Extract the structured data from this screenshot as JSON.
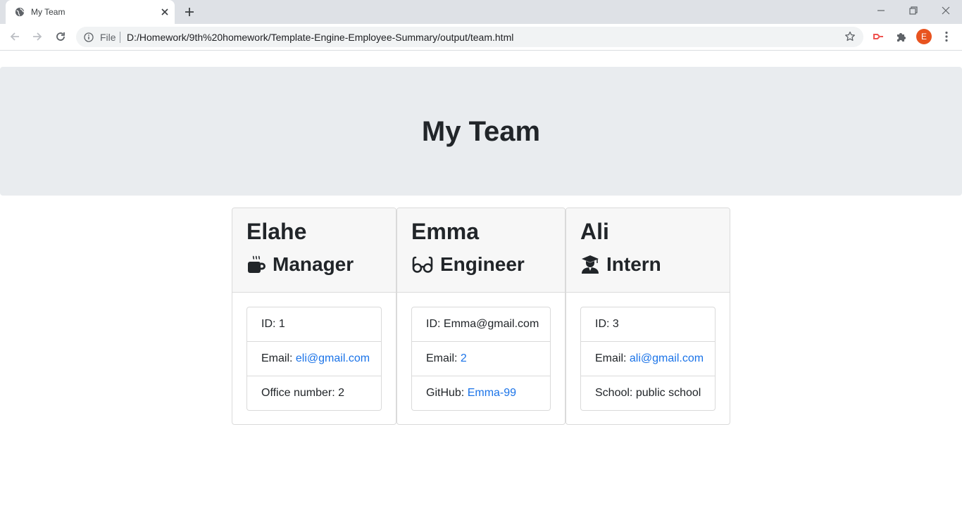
{
  "browser": {
    "tab_title": "My Team",
    "omnibox_scheme": "File",
    "url": "D:/Homework/9th%20homework/Template-Engine-Employee-Summary/output/team.html",
    "profile_initial": "E",
    "profile_color": "#e8531f"
  },
  "page": {
    "title": "My Team"
  },
  "team": [
    {
      "name": "Elahe",
      "role": "Manager",
      "icon": "mug-icon",
      "id_label": "ID:",
      "id_value": "1",
      "email_label": "Email:",
      "email_value": "eli@gmail.com",
      "extra_label": "Office number:",
      "extra_value": "2"
    },
    {
      "name": "Emma",
      "role": "Engineer",
      "icon": "glasses-icon",
      "id_label": "ID:",
      "id_value": "Emma@gmail.com",
      "email_label": "Email:",
      "email_value": "2",
      "extra_label": "GitHub:",
      "extra_value": "Emma-99"
    },
    {
      "name": "Ali",
      "role": "Intern",
      "icon": "graduate-icon",
      "id_label": "ID:",
      "id_value": "3",
      "email_label": "Email:",
      "email_value": "ali@gmail.com",
      "extra_label": "School:",
      "extra_value": "public school"
    }
  ]
}
